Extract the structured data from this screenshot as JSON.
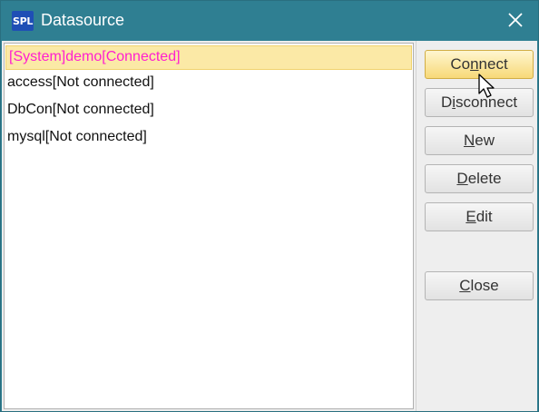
{
  "window": {
    "title": "Datasource",
    "app_icon_text": "SPL",
    "close_glyph": "✕"
  },
  "datasources": [
    {
      "label": "[System]demo[Connected]",
      "selected": true
    },
    {
      "label": "access[Not connected]",
      "selected": false
    },
    {
      "label": "DbCon[Not connected]",
      "selected": false
    },
    {
      "label": "mysql[Not connected]",
      "selected": false
    }
  ],
  "buttons": {
    "connect": {
      "pre": "Co",
      "mn": "n",
      "post": "nect"
    },
    "disconnect": {
      "pre": "D",
      "mn": "i",
      "post": "sconnect"
    },
    "new": {
      "pre": "",
      "mn": "N",
      "post": "ew"
    },
    "delete": {
      "pre": "",
      "mn": "D",
      "post": "elete"
    },
    "edit": {
      "pre": "",
      "mn": "E",
      "post": "dit"
    },
    "close": {
      "pre": "",
      "mn": "C",
      "post": "lose"
    }
  },
  "colors": {
    "titlebar": "#2f7f92",
    "selected_bg": "#fbe9a6",
    "selected_text": "#ff1fd0"
  }
}
